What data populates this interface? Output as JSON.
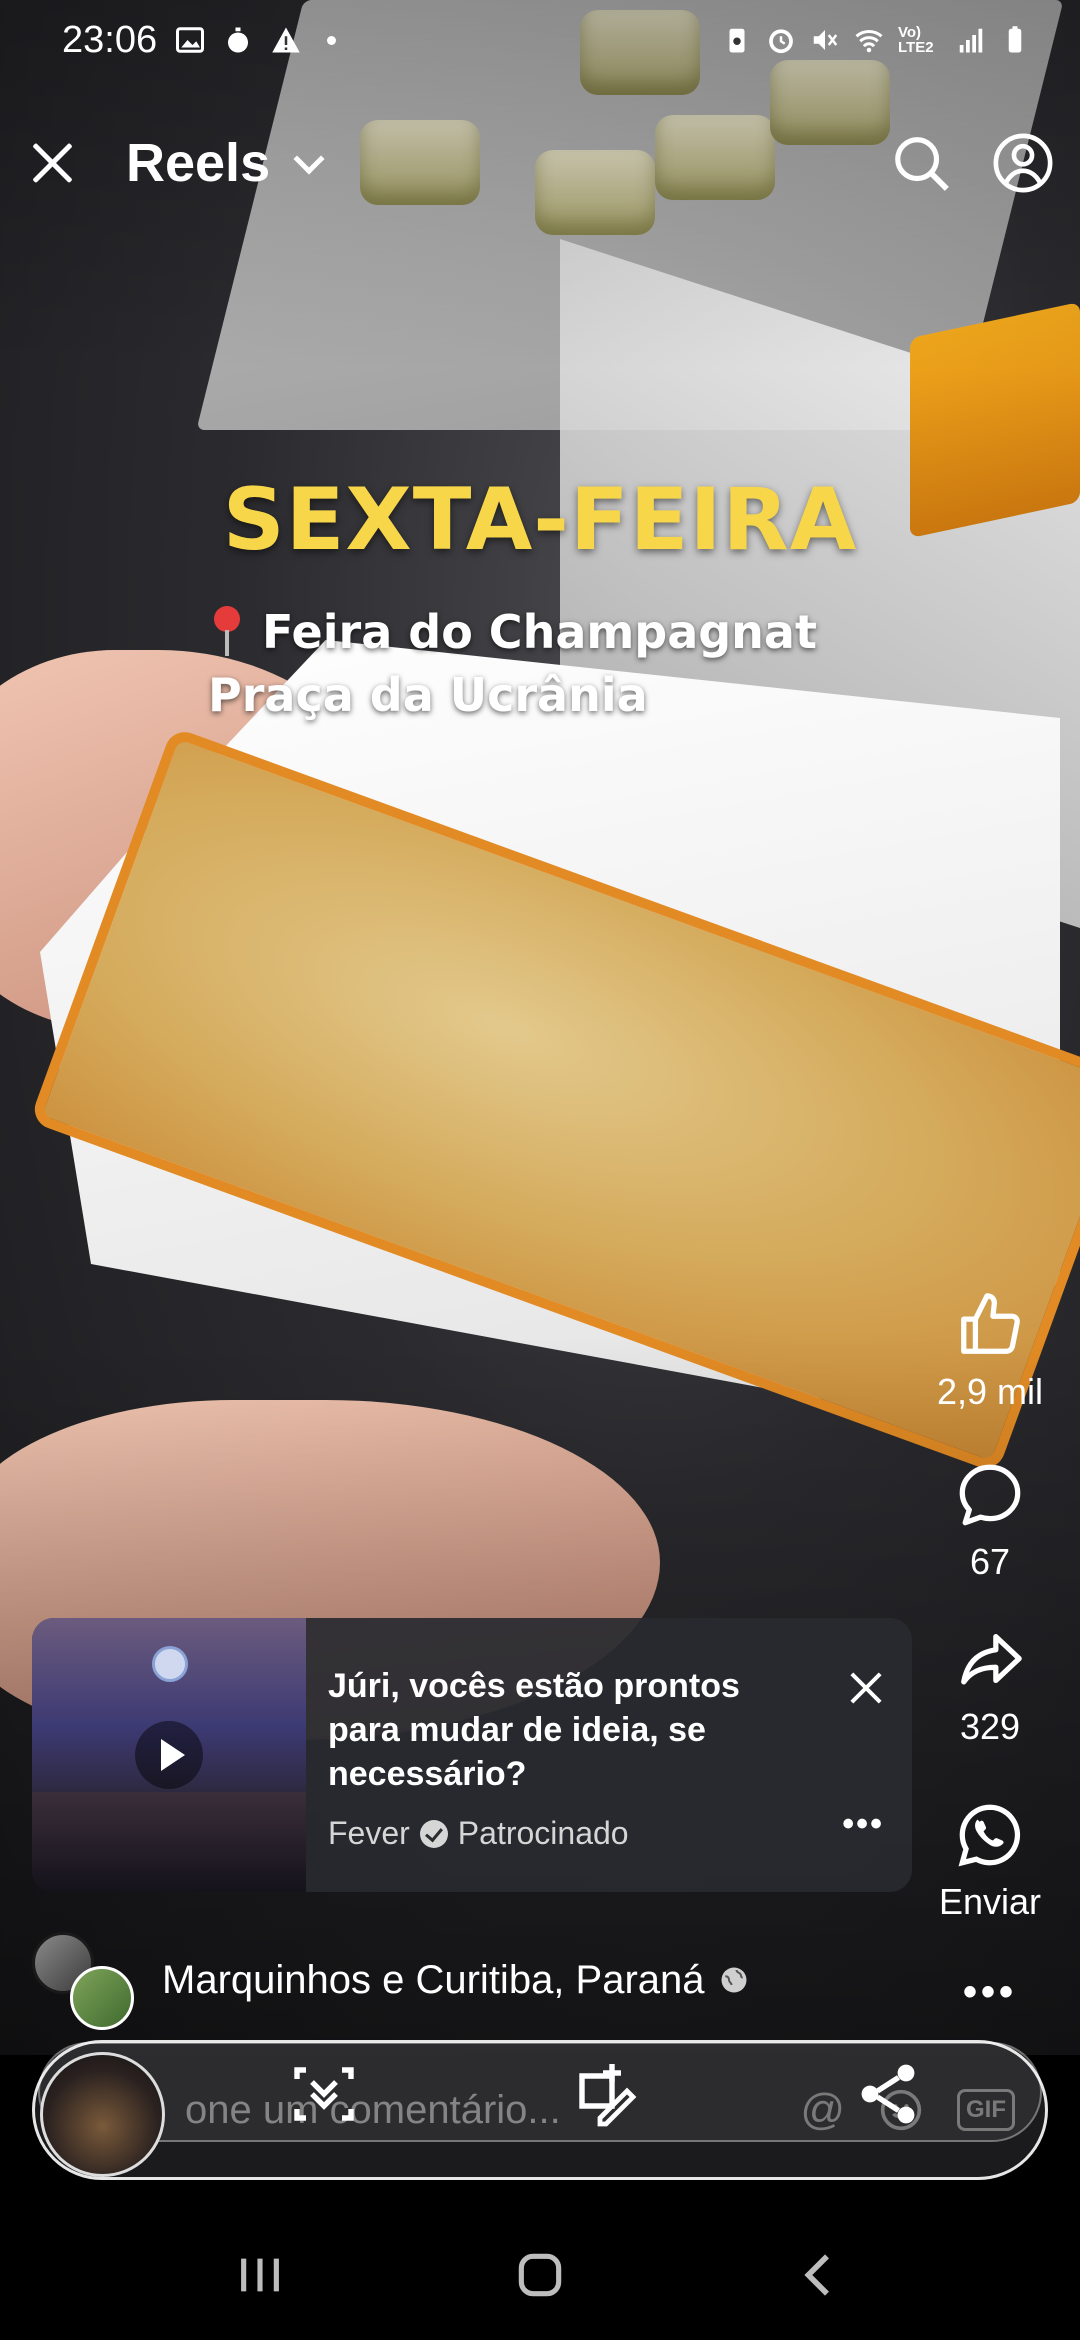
{
  "status_bar": {
    "time": "23:06",
    "network": "Vo) LTE2"
  },
  "header": {
    "title": "Reels"
  },
  "video_overlay": {
    "headline": "SEXTA-FEIRA",
    "location_line1": "Feira do Champagnat",
    "location_line2": "Praça da Ucrânia"
  },
  "actions": {
    "likes": "2,9 mil",
    "comments": "67",
    "shares": "329",
    "send_label": "Enviar"
  },
  "ad": {
    "title": "Júri, vocês estão prontos para mudar de ideia, se necessário?",
    "advertiser": "Fever",
    "sponsored_label": "Patrocinado"
  },
  "author": {
    "name": "Marquinhos e Curitiba, Paraná"
  },
  "comment": {
    "placeholder": "one um comentário..."
  },
  "colors": {
    "headline": "#f7d64a",
    "background": "#000000"
  }
}
